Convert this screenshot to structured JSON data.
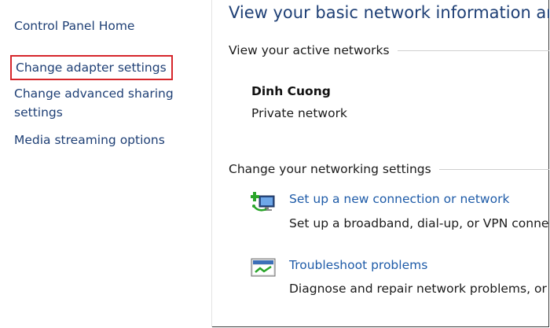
{
  "sidebar": {
    "items": [
      {
        "label": "Control Panel Home"
      },
      {
        "label": "Change adapter settings"
      },
      {
        "label": "Change advanced sharing settings"
      },
      {
        "label": "Media streaming options"
      }
    ]
  },
  "main": {
    "title": "View your basic network information and",
    "active_networks": {
      "heading": "View your active networks",
      "network_name": "Dinh Cuong",
      "network_type": "Private network"
    },
    "settings": {
      "heading": "Change your networking settings",
      "tasks": [
        {
          "icon": "new-connection-icon",
          "link": "Set up a new connection or network",
          "description": "Set up a broadband, dial-up, or VPN connect"
        },
        {
          "icon": "troubleshoot-icon",
          "link": "Troubleshoot problems",
          "description": "Diagnose and repair network problems, or g"
        }
      ]
    }
  },
  "colors": {
    "link": "#1e5ba8",
    "sidebar_link": "#1e3f75",
    "highlight_border": "#d6262b"
  }
}
